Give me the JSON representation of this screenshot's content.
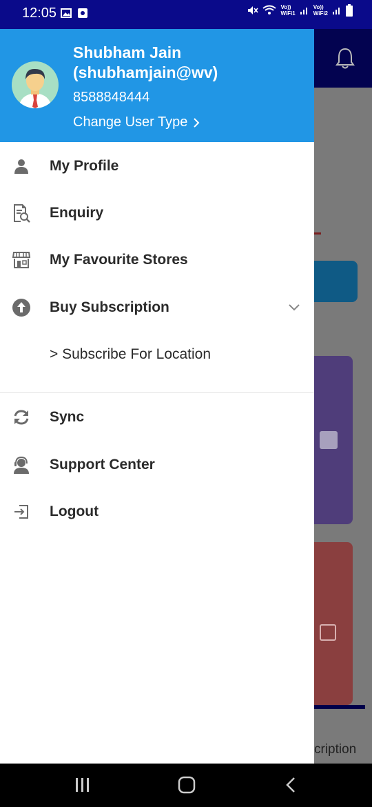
{
  "status": {
    "time": "12:05",
    "left_icons": [
      "image-icon",
      "notification-square-icon"
    ],
    "right_icons": [
      "mute-icon",
      "wifi-icon",
      "signal-icon",
      "signal-icon",
      "battery-icon"
    ],
    "sim1_label": "Vo))\nWiFi1",
    "sim2_label": "Vo))\nWiFi2"
  },
  "drawer": {
    "user": {
      "name": "Shubham Jain",
      "handle": "(shubhamjain@wv)",
      "phone": "8588848444",
      "change_type_label": "Change User Type",
      "change_type_icon": "chevron-right-icon"
    },
    "items": [
      {
        "label": "My Profile",
        "icon": "person-icon"
      },
      {
        "label": "Enquiry",
        "icon": "document-search-icon"
      },
      {
        "label": "My Favourite Stores",
        "icon": "store-icon"
      },
      {
        "label": "Buy Subscription",
        "icon": "upload-circle-icon",
        "expanded": true
      },
      {
        "label": "> Subscribe For Location"
      },
      {
        "label": "Sync",
        "icon": "sync-icon"
      },
      {
        "label": "Support Center",
        "icon": "support-agent-icon"
      },
      {
        "label": "Logout",
        "icon": "logout-icon"
      }
    ]
  },
  "background": {
    "bottom_label": "cription",
    "header_icon": "bell-icon"
  },
  "colors": {
    "status_bar": "#0a0a8a",
    "drawer_header": "#2196e5",
    "text": "#2b2b2b",
    "icon": "#6b6b6b"
  }
}
